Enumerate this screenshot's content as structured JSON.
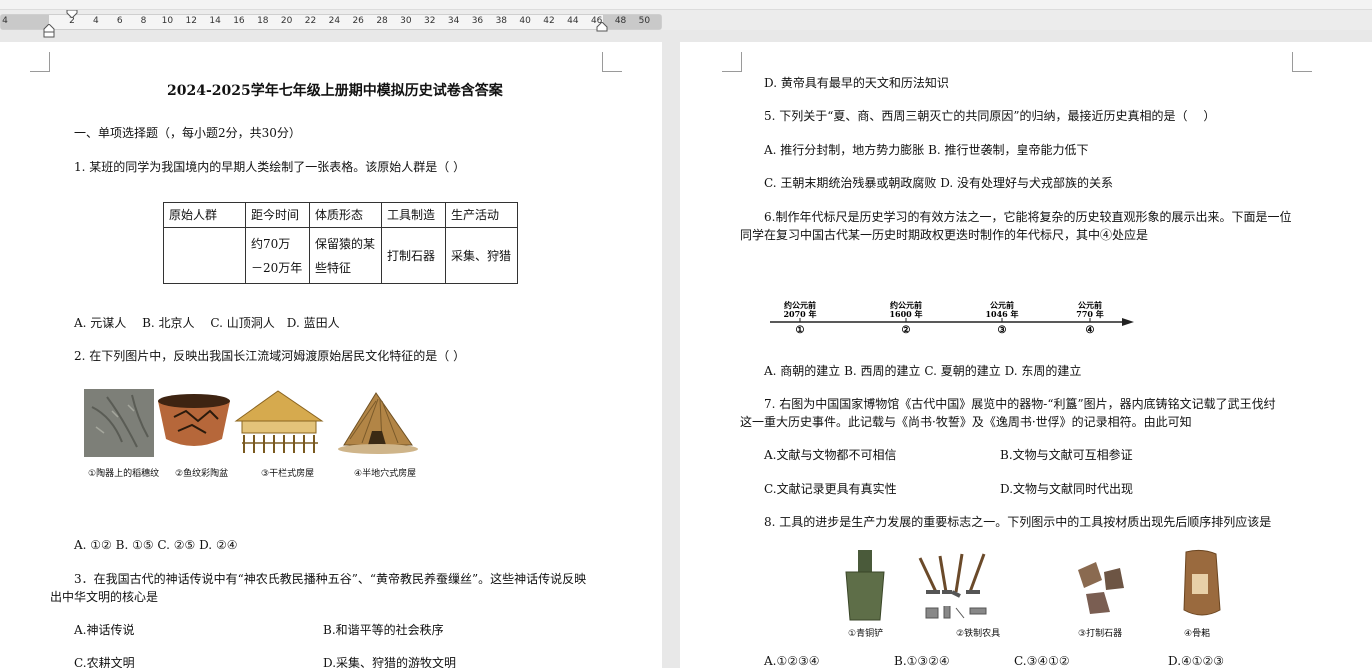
{
  "ruler": {
    "left_edge": "4",
    "ticks": [
      "2",
      "4",
      "6",
      "8",
      "10",
      "12",
      "14",
      "16",
      "18",
      "20",
      "22",
      "24",
      "26",
      "28",
      "30",
      "32",
      "34",
      "36",
      "38",
      "40",
      "42",
      "44",
      "46",
      "48",
      "50"
    ]
  },
  "left_page": {
    "title": "2024-2025学年七年级上册期中模拟历史试卷含答案",
    "section": "一、单项选择题（，每小题2分，共30分）",
    "q1": {
      "stem": "1. 某班的同学为我国境内的早期人类绘制了一张表格。该原始人群是（ ）",
      "table_headers": [
        "原始人群",
        "距今时间",
        "体质形态",
        "工具制造",
        "生产活动"
      ],
      "table_row": {
        "group": "",
        "time_line1": "约70万",
        "time_line2": "－20万年",
        "form_line1": "保留猿的某",
        "form_line2": "些特征",
        "tools": "打制石器",
        "activity": "采集、狩猎"
      },
      "options": "A. 元谋人　 B. 北京人　 C. 山顶洞人　D. 蓝田人"
    },
    "q2": {
      "stem": "2. 在下列图片中，反映出我国长江流域河姆渡原始居民文化特征的是（ ）",
      "captions": [
        "①陶器上的稻穗纹",
        "②鱼纹彩陶盆",
        "③干栏式房屋",
        "④半地穴式房屋"
      ],
      "options": "A. ①② B. ①⑤ C. ②⑤ D. ②④"
    },
    "q3": {
      "stem_line1": "3．在我国古代的神话传说中有“神农氏教民播种五谷”、“黄帝教民养蚕缫丝”。这些神话传说反映",
      "stem_line2": "出中华文明的核心是",
      "optA": "A.神话传说",
      "optB": "B.和谐平等的社会秩序",
      "optC": "C.农耕文明",
      "optD": "D.采集、狩猎的游牧文明"
    }
  },
  "right_page": {
    "q4_optD": "D. 黄帝具有最早的天文和历法知识",
    "q5": {
      "stem": "5. 下列关于“夏、商、西周三朝灭亡的共同原因”的归纳，最接近历史真相的是（　 ）",
      "optAB": "A. 推行分封制，地方势力膨胀 B. 推行世袭制，皇帝能力低下",
      "optCD": "C. 王朝末期统治残暴或朝政腐败 D. 没有处理好与犬戎部族的关系"
    },
    "q6": {
      "stem_line1": "6.制作年代标尺是历史学习的有效方法之一，它能将复杂的历史较直观形象的展示出来。下面是一位",
      "stem_line2": "同学在复习中国古代某一历史时期政权更迭时制作的年代标尺，其中④处应是",
      "timeline": [
        {
          "label1": "约公元前",
          "label2": "2070 年",
          "num": "①"
        },
        {
          "label1": "约公元前",
          "label2": "1600 年",
          "num": "②"
        },
        {
          "label1": "公元前",
          "label2": "1046 年",
          "num": "③"
        },
        {
          "label1": "公元前",
          "label2": "770 年",
          "num": "④"
        }
      ],
      "options": "A. 商朝的建立 B. 西周的建立 C. 夏朝的建立 D. 东周的建立"
    },
    "q7": {
      "stem_line1": "7. 右图为中国国家博物馆《古代中国》展览中的器物-“利簋”图片，器内底铸铭文记载了武王伐纣",
      "stem_line2": "这一重大历史事件。此记载与《尚书·牧誓》及《逸周书·世俘》的记录相符。由此可知",
      "optA": "A.文献与文物都不可相信",
      "optB": "B.文物与文献可互相参证",
      "optC": "C.文献记录更具有真实性",
      "optD": "D.文物与文献同时代出现"
    },
    "q8": {
      "stem": "8. 工具的进步是生产力发展的重要标志之一。下列图示中的工具按材质出现先后顺序排列应该是",
      "captions": [
        "①青铜铲",
        "②铁制农具",
        "③打制石器",
        "④骨耜"
      ],
      "optA": "A.①②③④",
      "optB": "B.①③②④",
      "optC": "C.③④①②",
      "optD": "D.④①②③"
    }
  }
}
